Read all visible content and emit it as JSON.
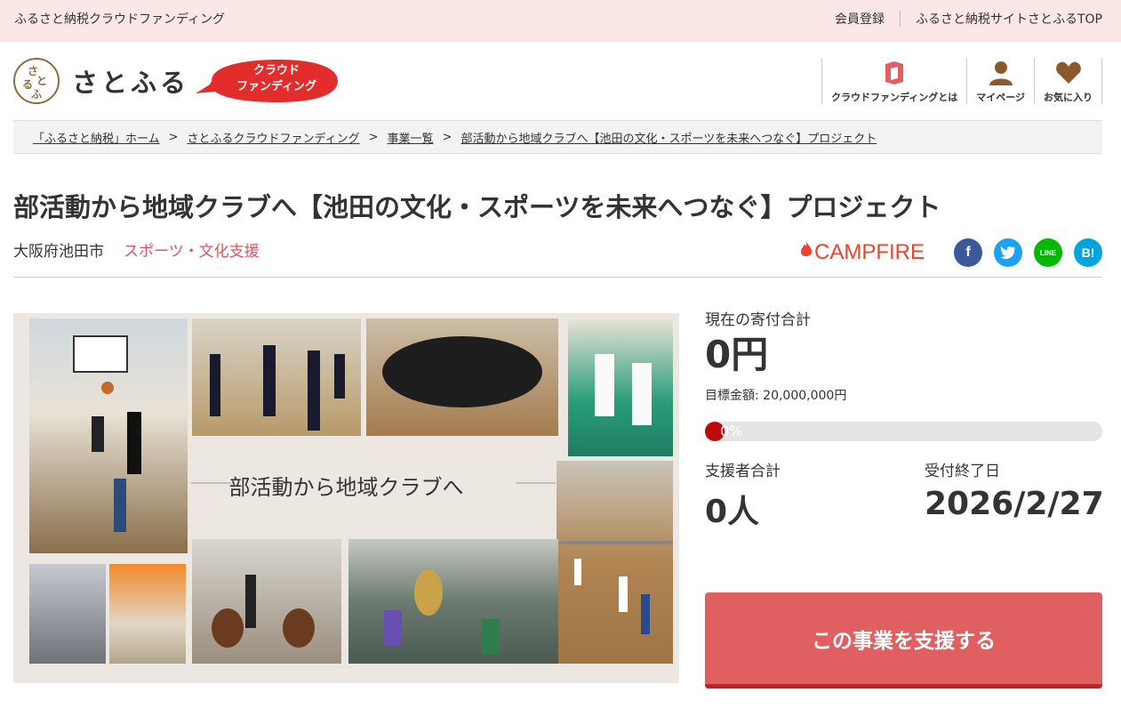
{
  "topbar": {
    "site_label": "ふるさと納税クラウドファンディング",
    "links": [
      "会員登録",
      "ふるさと納税サイトさとふるTOP"
    ]
  },
  "header": {
    "logo_text": "さとふる",
    "badge_line1": "クラウド",
    "badge_line2": "ファンディング",
    "badge_color": "#e32c2c",
    "nav": [
      {
        "label": "クラウドファンディングとは",
        "icon": "book-icon"
      },
      {
        "label": "マイページ",
        "icon": "user-icon"
      },
      {
        "label": "お気に入り",
        "icon": "heart-icon"
      }
    ]
  },
  "breadcrumb": [
    "「ふるさと納税」ホーム",
    "さとふるクラウドファンディング",
    "事業一覧",
    "部活動から地域クラブへ【池田の文化・スポーツを未来へつなぐ】プロジェクト"
  ],
  "project": {
    "title": "部活動から地域クラブへ【池田の文化・スポーツを未来へつなぐ】プロジェクト",
    "city": "大阪府池田市",
    "category": "スポーツ・文化支援",
    "partner": "CAMPFIRE",
    "image_caption": "部活動から地域クラブへ"
  },
  "social": [
    {
      "name": "facebook",
      "glyph": "f",
      "color": "#3b5998"
    },
    {
      "name": "twitter",
      "glyph": "t",
      "color": "#1da1f2"
    },
    {
      "name": "line",
      "glyph": "LINE",
      "color": "#00b900"
    },
    {
      "name": "hatena",
      "glyph": "B!",
      "color": "#00a4de"
    }
  ],
  "panel": {
    "total_label": "現在の寄付合計",
    "total_value": "0円",
    "goal_text": "目標金額: 20,000,000円",
    "progress_percent": 0,
    "progress_label": "0%",
    "supporters_label": "支援者合計",
    "supporters_value": "0人",
    "deadline_label": "受付終了日",
    "deadline_value": "2026/2/27",
    "support_button": "この事業を支援する"
  }
}
